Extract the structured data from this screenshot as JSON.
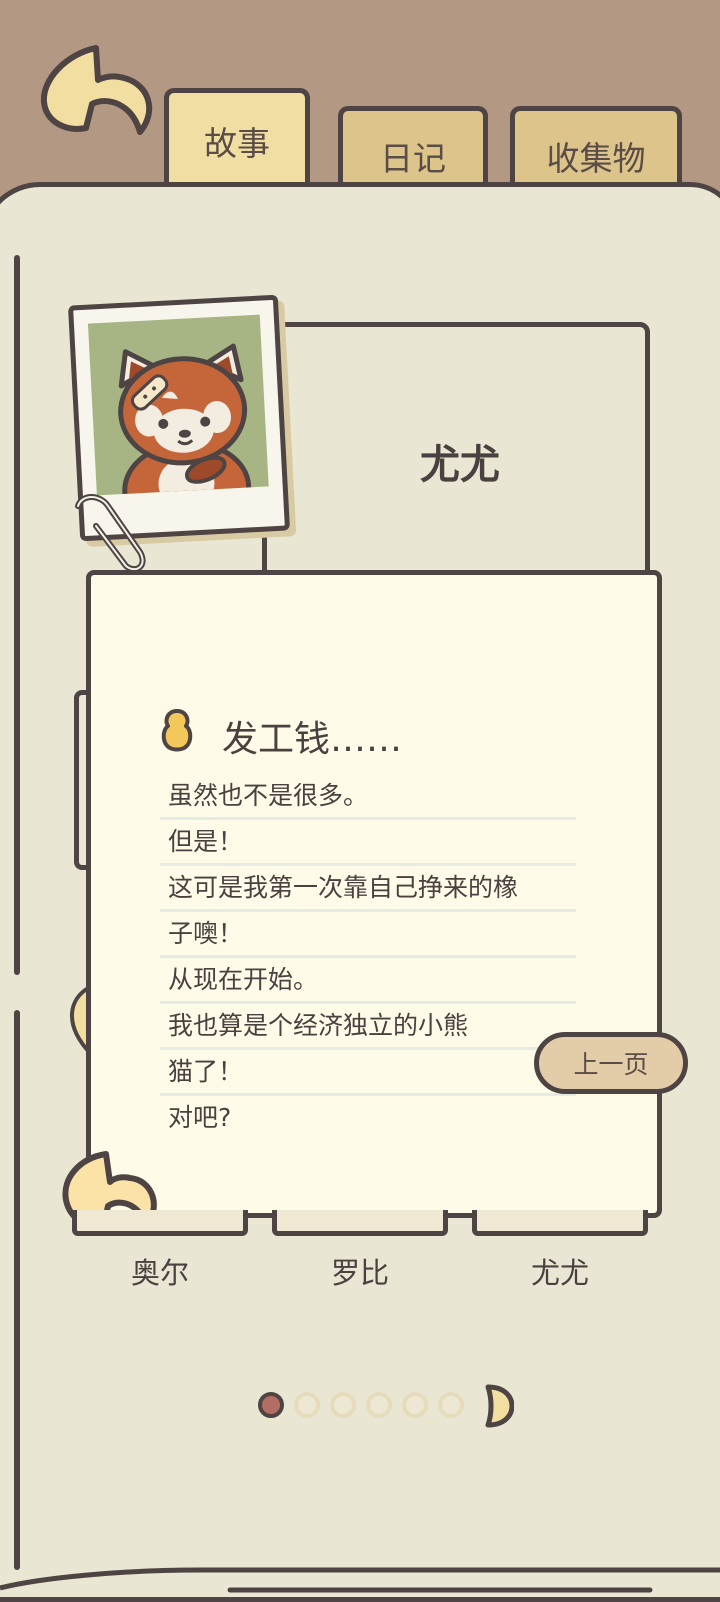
{
  "tabs": [
    {
      "label": "故事",
      "active": true
    },
    {
      "label": "日记",
      "active": false
    },
    {
      "label": "收集物",
      "active": false
    }
  ],
  "character": {
    "name": "尤尤",
    "photo_icon": "red-panda-portrait"
  },
  "story": {
    "title": "发工钱……",
    "lines": [
      "虽然也不是很多。",
      "但是！",
      "这可是我第一次靠自己挣来的橡",
      "子噢！",
      "从现在开始。",
      "我也算是个经济独立的小熊",
      "猫了！",
      "对吧?"
    ],
    "prev_button": "上一页"
  },
  "character_tabs": [
    "奥尔",
    "罗比",
    "尤尤"
  ],
  "pagination": {
    "total": 6,
    "current": 1
  },
  "colors": {
    "outline": "#4f4444",
    "page": "#e9e6d3",
    "paper": "#fefbe8",
    "accent_yellow": "#f0dea3",
    "active_dot": "#b26e64"
  }
}
